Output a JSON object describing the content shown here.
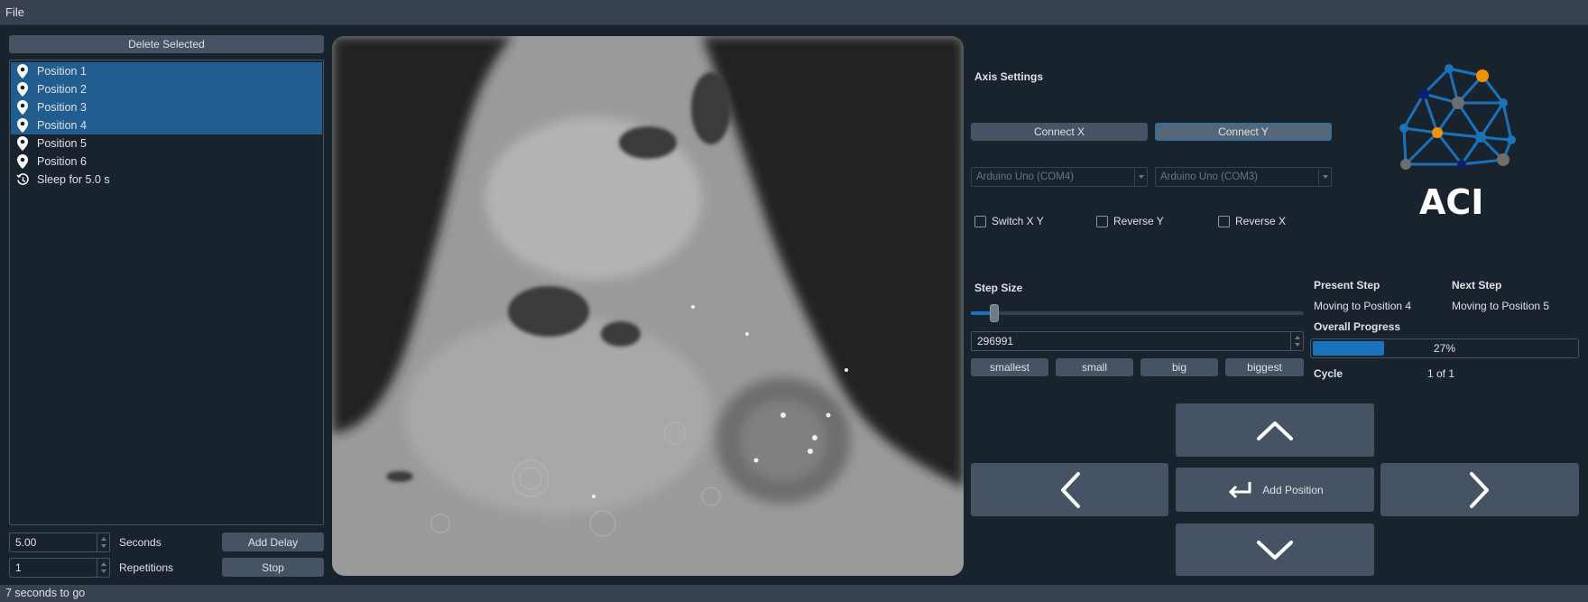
{
  "menubar": {
    "file": "File"
  },
  "left": {
    "delete_selected": "Delete Selected",
    "items": [
      {
        "label": "Position 1",
        "icon": "location-pin-icon",
        "selected": true
      },
      {
        "label": "Position 2",
        "icon": "location-pin-icon",
        "selected": true
      },
      {
        "label": "Position 3",
        "icon": "location-pin-icon",
        "selected": true
      },
      {
        "label": "Position 4",
        "icon": "location-pin-icon",
        "selected": true
      },
      {
        "label": "Position 5",
        "icon": "location-pin-icon",
        "selected": false
      },
      {
        "label": "Position 6",
        "icon": "location-pin-icon",
        "selected": false
      },
      {
        "label": "Sleep for 5.0 s",
        "icon": "history-clock-icon",
        "selected": false
      }
    ],
    "seconds_value": "5.00",
    "seconds_label": "Seconds",
    "add_delay": "Add Delay",
    "repetitions_value": "1",
    "repetitions_label": "Repetitions",
    "stop": "Stop"
  },
  "axis": {
    "title": "Axis Settings",
    "connect_x": "Connect X",
    "connect_y": "Connect Y",
    "combo_x": "Arduino Uno (COM4)",
    "combo_y": "Arduino Uno (COM3)",
    "switch_xy": "Switch X Y",
    "reverse_y": "Reverse Y",
    "reverse_x": "Reverse X"
  },
  "logo": {
    "text": "ACI"
  },
  "step": {
    "title": "Step Size",
    "value": "296991",
    "slider_fraction": 0.07,
    "smallest": "smallest",
    "small": "small",
    "big": "big",
    "biggest": "biggest"
  },
  "status": {
    "present_step_label": "Present Step",
    "present_step_value": "Moving to Position 4",
    "next_step_label": "Next Step",
    "next_step_value": "Moving to Position 5",
    "overall_label": "Overall Progress",
    "progress_text": "27%",
    "progress_fraction": 0.27,
    "cycle_label": "Cycle",
    "cycle_value": "1 of 1"
  },
  "nav": {
    "add_position": "Add Position"
  },
  "statusbar": {
    "text": "7 seconds to go"
  },
  "colors": {
    "accent": "#1a72bb",
    "background": "#19232d",
    "button": "#455364",
    "selection": "#215d8f"
  }
}
